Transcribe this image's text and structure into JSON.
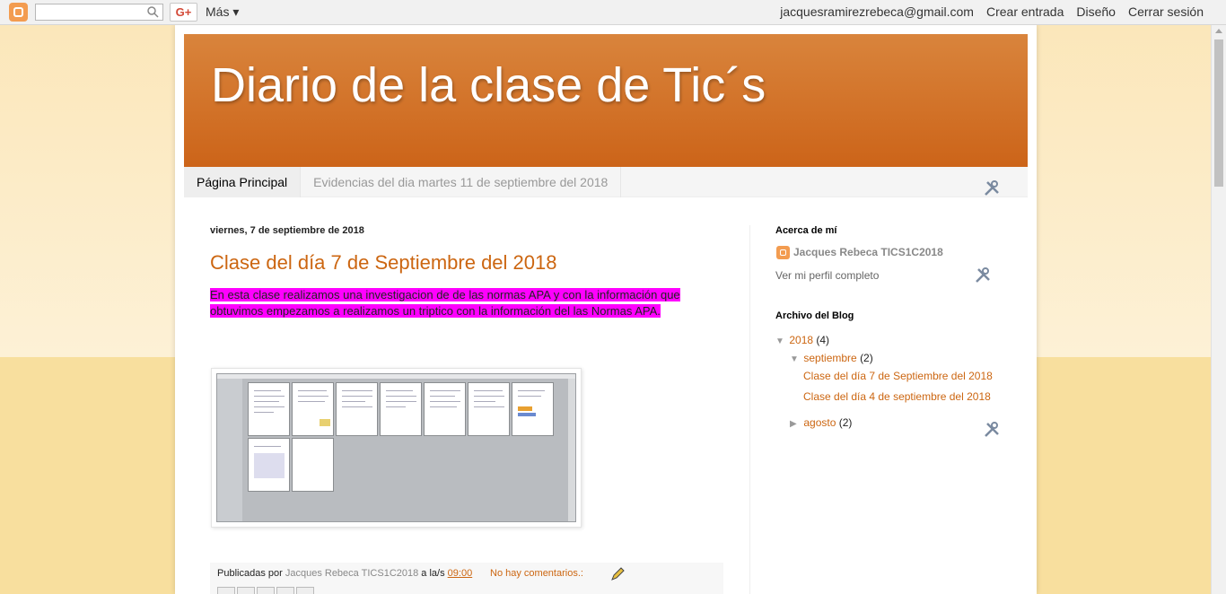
{
  "navbar": {
    "search_placeholder": "",
    "gplus_label": "G+",
    "more_label": "Más ▾",
    "email": "jacquesramirezrebeca@gmail.com",
    "create_post": "Crear entrada",
    "design": "Diseño",
    "sign_out": "Cerrar sesión"
  },
  "header": {
    "title": "Diario de la clase de Tic´s"
  },
  "tabs": [
    {
      "label": "Página Principal",
      "active": true
    },
    {
      "label": "Evidencias del dia martes 11 de septiembre del 2018",
      "active": false
    }
  ],
  "post": {
    "date": "viernes, 7 de septiembre de 2018",
    "title": "Clase del día 7 de Septiembre del 2018",
    "body": "En esta clase realizamos una  investigacion de de las normas APA  y con la información que obtuvimos empezamos a realizamos un triptico con la información del las Normas APA.",
    "highlight_color": "#ff00ff",
    "footer": {
      "published_by": "Publicadas por",
      "author": "Jacques Rebeca TICS1C2018",
      "at": "a la/s",
      "time": "09:00",
      "comments": "No hay comentarios.:"
    }
  },
  "sidebar": {
    "about_title": "Acerca de mí",
    "profile_name": "Jacques Rebeca TICS1C2018",
    "profile_link": "Ver mi perfil completo",
    "archive_title": "Archivo del Blog",
    "archive": {
      "year": "2018",
      "year_count": "(4)",
      "month": "septiembre",
      "month_count": "(2)",
      "posts": [
        "Clase del día 7 de Septiembre del 2018",
        "Clase del día 4 de septiembre del 2018"
      ],
      "other_month": "agosto",
      "other_month_count": "(2)"
    }
  },
  "colors": {
    "accent": "#cc6611",
    "header_top": "#d9843c",
    "header_bottom": "#cc6419",
    "background": "#f8df9e"
  }
}
